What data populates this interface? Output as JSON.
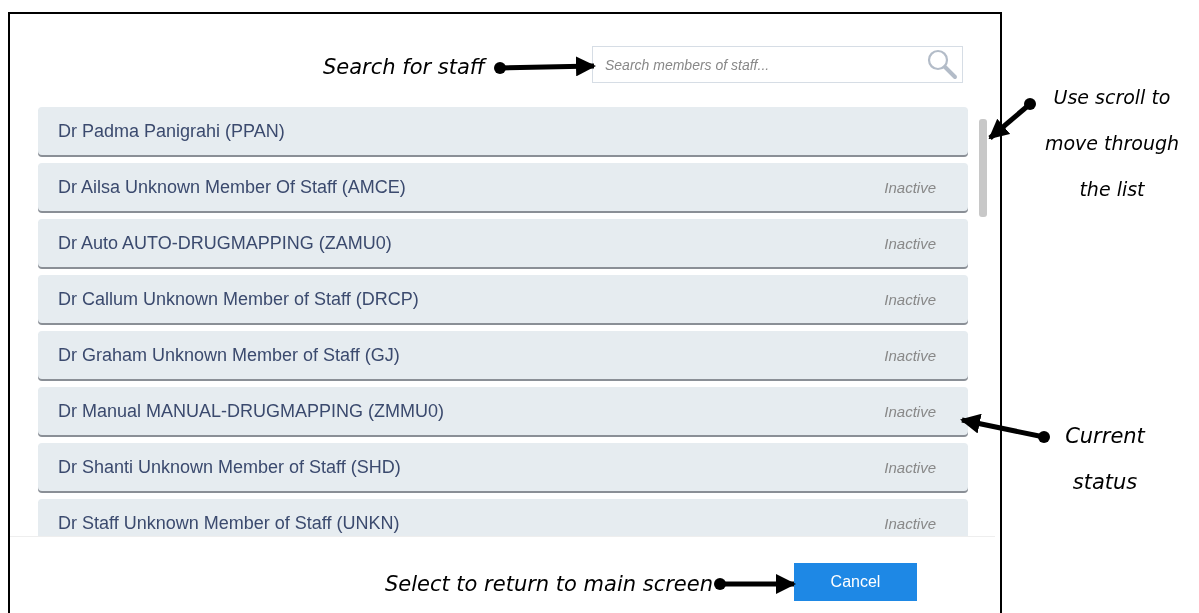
{
  "search": {
    "placeholder": "Search members of staff..."
  },
  "staff_list": [
    {
      "name": "Dr Padma Panigrahi (PPAN)"
    },
    {
      "name": "Dr Ailsa Unknown Member Of Staff (AMCE)",
      "status": "Inactive"
    },
    {
      "name": "Dr Auto AUTO-DRUGMAPPING (ZAMU0)",
      "status": "Inactive"
    },
    {
      "name": "Dr Callum Unknown Member of Staff (DRCP)",
      "status": "Inactive"
    },
    {
      "name": "Dr Graham Unknown Member of Staff (GJ)",
      "status": "Inactive"
    },
    {
      "name": "Dr Manual MANUAL-DRUGMAPPING (ZMMU0)",
      "status": "Inactive"
    },
    {
      "name": "Dr Shanti Unknown Member of Staff (SHD)",
      "status": "Inactive"
    },
    {
      "name": "Dr Staff Unknown Member of Staff (UNKN)",
      "status": "Inactive"
    }
  ],
  "buttons": [
    "Cancel"
  ],
  "annotations": [
    {
      "kind": "search",
      "text": "Search for staff"
    },
    {
      "kind": "scroll",
      "text": "Use scroll to move through the list"
    },
    {
      "kind": "status",
      "text": "Current status"
    },
    {
      "kind": "cancel",
      "text": "Select to return to main screen"
    }
  ]
}
